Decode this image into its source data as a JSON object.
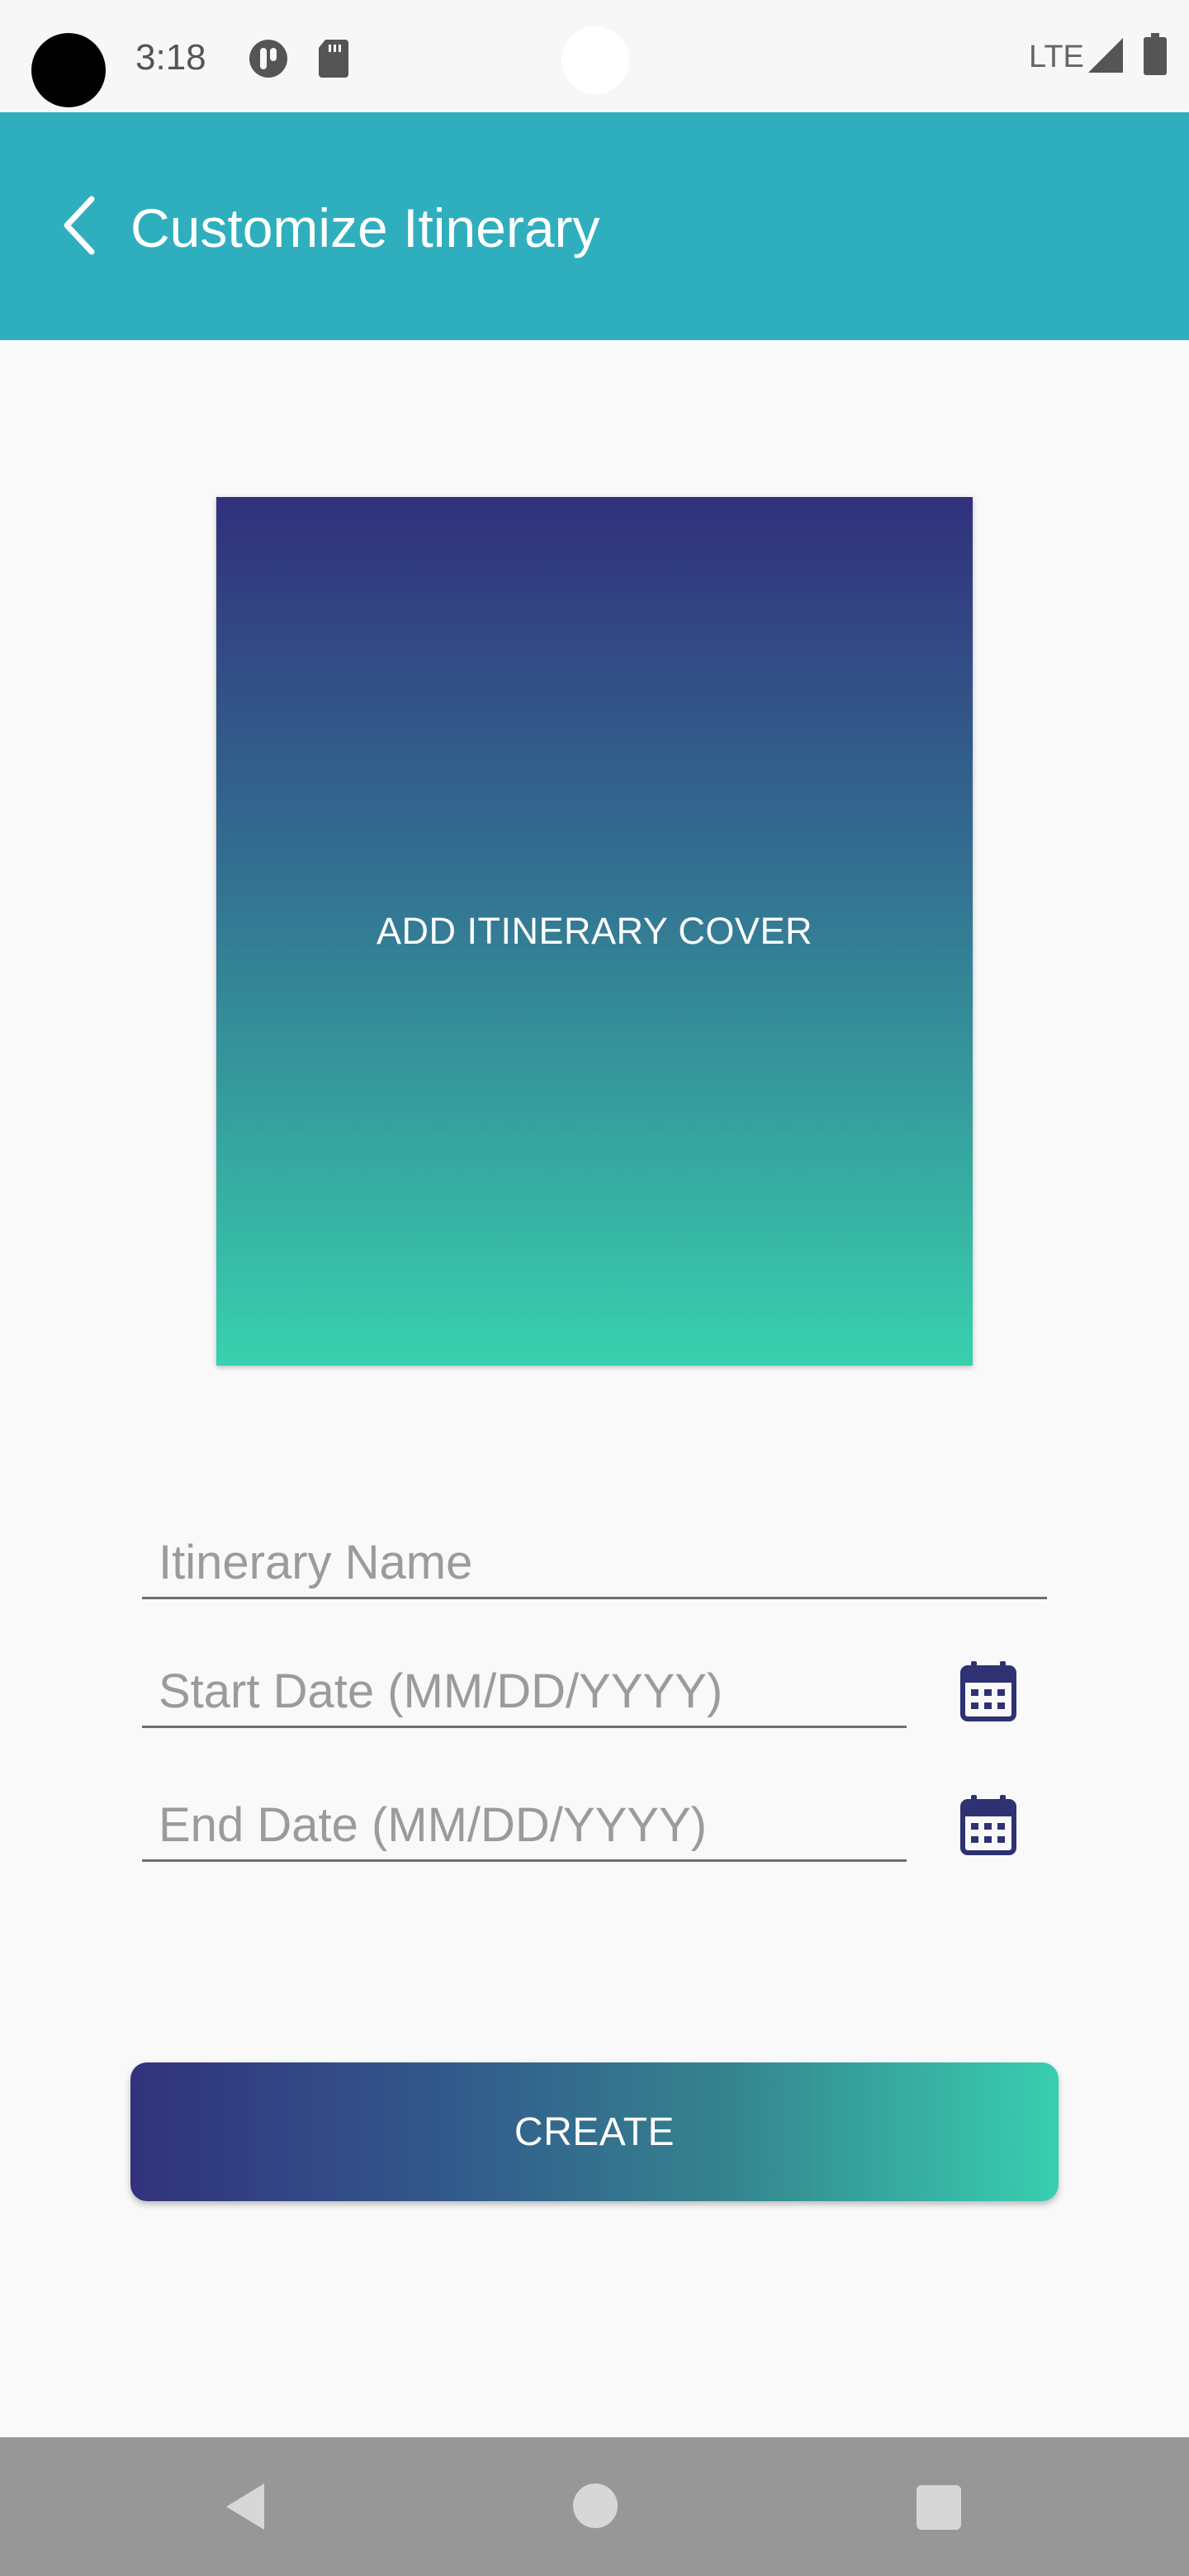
{
  "status_bar": {
    "time": "3:18",
    "network": "LTE",
    "icons": [
      "camera-cutout",
      "notification-app-icon",
      "sd-card-icon",
      "signal-icon",
      "battery-icon"
    ]
  },
  "app_bar": {
    "title": "Customize Itinerary",
    "back_icon": "chevron-left-icon",
    "color": "#2fafbe"
  },
  "cover": {
    "label": "ADD ITINERARY COVER",
    "gradient_top": "#31307c",
    "gradient_bottom": "#38d1ae"
  },
  "form": {
    "name": {
      "value": "",
      "placeholder": "Itinerary Name"
    },
    "start_date": {
      "value": "",
      "placeholder": "Start Date (MM/DD/YYYY)",
      "icon": "calendar-icon"
    },
    "end_date": {
      "value": "",
      "placeholder": "End Date (MM/DD/YYYY)",
      "icon": "calendar-icon"
    }
  },
  "create_button": {
    "label": "CREATE",
    "gradient_left": "#32327c",
    "gradient_right": "#38cfb0"
  },
  "nav_bar": {
    "icons": [
      "back-triangle-icon",
      "home-circle-icon",
      "recents-square-icon"
    ]
  }
}
